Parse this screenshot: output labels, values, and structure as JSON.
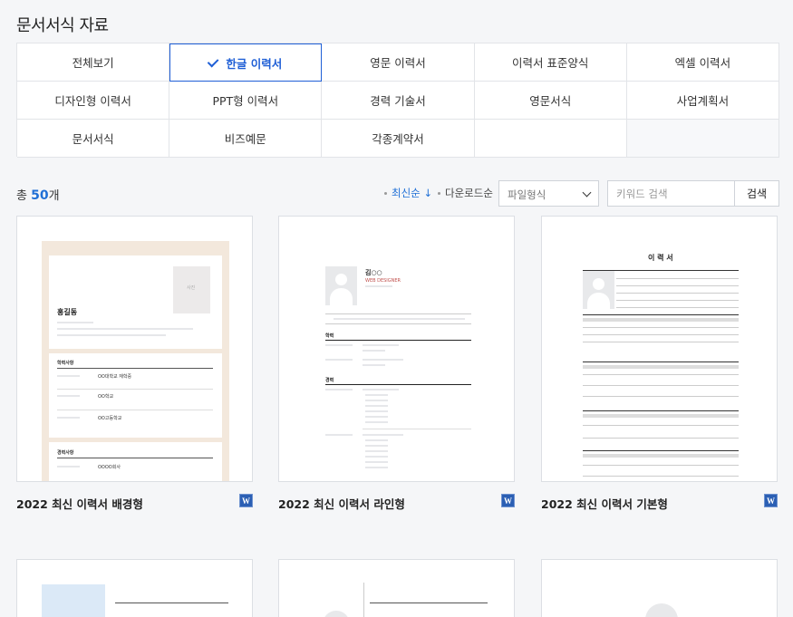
{
  "page_title": "문서서식 자료",
  "categories": [
    "전체보기",
    "한글 이력서",
    "영문 이력서",
    "이력서 표준양식",
    "엑셀 이력서",
    "디자인형 이력서",
    "PPT형 이력서",
    "경력 기술서",
    "영문서식",
    "사업계획서",
    "문서서식",
    "비즈예문",
    "각종계약서"
  ],
  "count": {
    "prefix": "총",
    "number": "50",
    "suffix": "개"
  },
  "sort": {
    "latest": "최신순",
    "latest_arrow": "↓",
    "downloads": "다운로드순"
  },
  "filter": {
    "file_type": "파일형식"
  },
  "search": {
    "placeholder": "키워드 검색",
    "button": "검색"
  },
  "cards": [
    {
      "title": "2022 최신 이력서 배경형",
      "file_icon": "W"
    },
    {
      "title": "2022 최신 이력서 라인형",
      "file_icon": "W"
    },
    {
      "title": "2022 최신 이력서 기본형",
      "file_icon": "W"
    }
  ],
  "thumb1": {
    "name": "홍길동",
    "photo": "사진",
    "sec1": "학력사항",
    "sec2": "경력사항",
    "school1": "OO대학교 재학중",
    "school2": "OO학교",
    "school3": "OO고등학교",
    "company": "OOOO회사"
  },
  "thumb2": {
    "name": "김○○",
    "sub": "WEB DESIGNER",
    "sec1": "학력",
    "sec2": "경력"
  },
  "thumb3": {
    "title": "이 력 서"
  },
  "colors": {
    "accent": "#1f5fd6",
    "border": "#e2e4e8",
    "thumb1_bg": "#f3e8dc"
  }
}
